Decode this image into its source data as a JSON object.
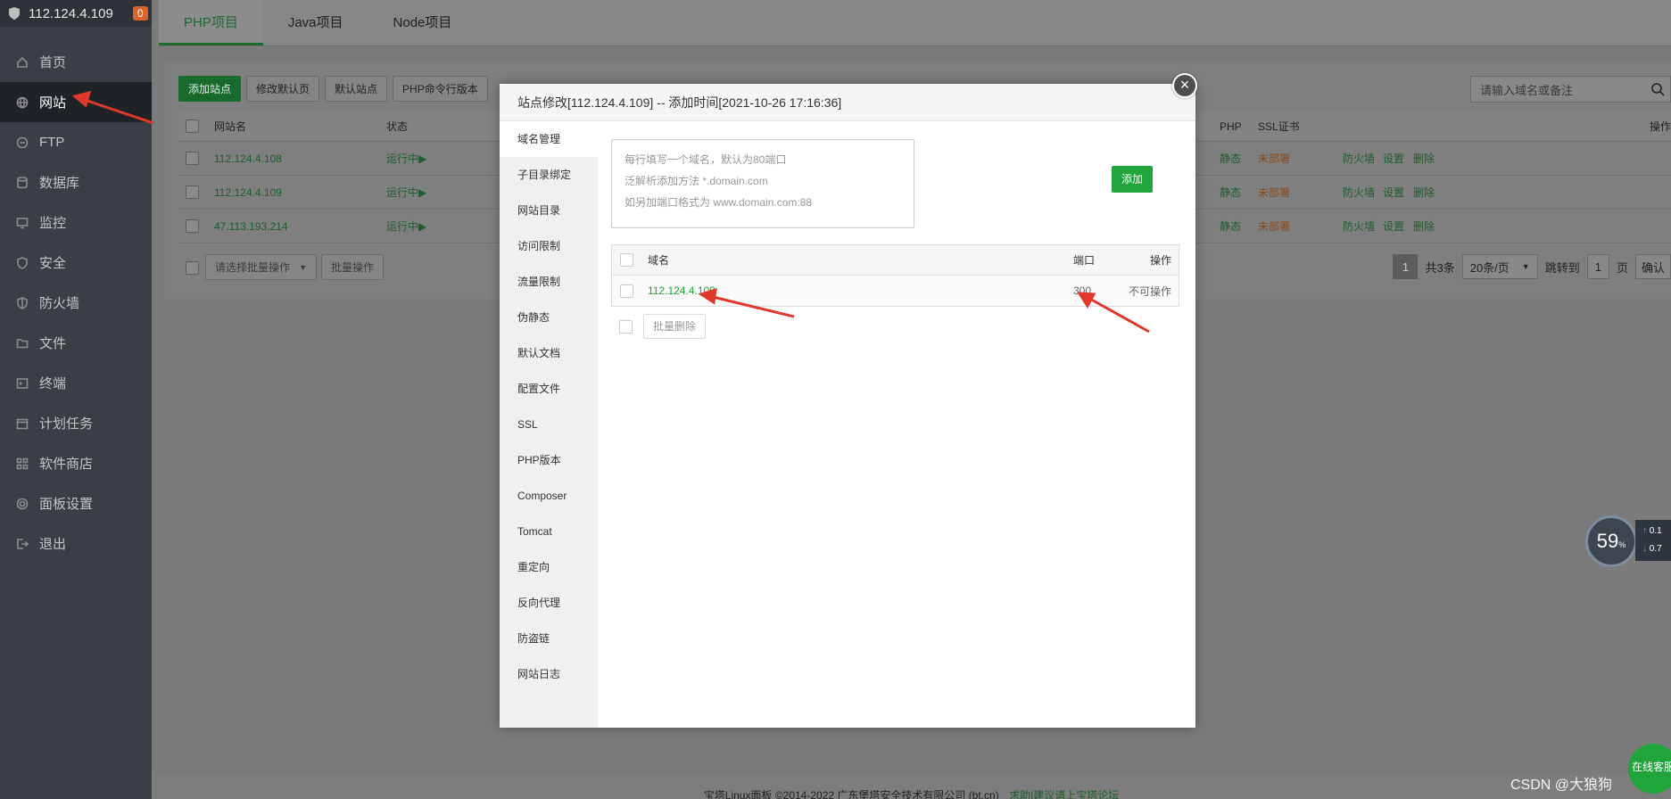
{
  "sidebar": {
    "host": "112.124.4.109",
    "badge": "0",
    "items": [
      {
        "label": "首页",
        "icon": "home-icon"
      },
      {
        "label": "网站",
        "icon": "globe-icon"
      },
      {
        "label": "FTP",
        "icon": "ftp-icon"
      },
      {
        "label": "数据库",
        "icon": "database-icon"
      },
      {
        "label": "监控",
        "icon": "monitor-icon"
      },
      {
        "label": "安全",
        "icon": "shield-icon"
      },
      {
        "label": "防火墙",
        "icon": "firewall-icon"
      },
      {
        "label": "文件",
        "icon": "folder-icon"
      },
      {
        "label": "终端",
        "icon": "terminal-icon"
      },
      {
        "label": "计划任务",
        "icon": "calendar-icon"
      },
      {
        "label": "软件商店",
        "icon": "apps-icon"
      },
      {
        "label": "面板设置",
        "icon": "gear-icon"
      },
      {
        "label": "退出",
        "icon": "logout-icon"
      }
    ]
  },
  "tabs": [
    "PHP项目",
    "Java项目",
    "Node项目"
  ],
  "toolbar": {
    "add_site": "添加站点",
    "edit_default_page": "修改默认页",
    "default_site": "默认站点",
    "php_cli": "PHP命令行版本"
  },
  "search": {
    "placeholder": "请输入域名或备注"
  },
  "table": {
    "headers": {
      "name": "网站名",
      "status": "状态",
      "php": "PHP",
      "ssl": "SSL证书",
      "ops": "操作"
    },
    "rows": [
      {
        "name": "112.124.4.108",
        "status": "运行中▶",
        "php": "静态",
        "ssl": "未部署",
        "firewall": "防火墙",
        "settings": "设置",
        "delete": "删除"
      },
      {
        "name": "112.124.4.109",
        "status": "运行中▶",
        "php": "静态",
        "ssl": "未部署",
        "firewall": "防火墙",
        "settings": "设置",
        "delete": "删除"
      },
      {
        "name": "47.113.193.214",
        "status": "运行中▶",
        "php": "静态",
        "ssl": "未部署",
        "firewall": "防火墙",
        "settings": "设置",
        "delete": "删除"
      }
    ],
    "batch_select": "请选择批量操作",
    "batch_btn": "批量操作"
  },
  "pager": {
    "current": "1",
    "total": "共3条",
    "per_page": "20条/页",
    "goto": "跳转到",
    "goto_value": "1",
    "page": "页",
    "confirm": "确认"
  },
  "footer": {
    "copyright": "宝塔Linux面板 ©2014-2022 广东堡塔安全技术有限公司 (bt.cn)",
    "feedback": "求助|建议请上宝塔论坛"
  },
  "modal": {
    "title": "站点修改[112.124.4.109] -- 添加时间[2021-10-26 17:16:36]",
    "menu": [
      "域名管理",
      "子目录绑定",
      "网站目录",
      "访问限制",
      "流量限制",
      "伪静态",
      "默认文档",
      "配置文件",
      "SSL",
      "PHP版本",
      "Composer",
      "Tomcat",
      "重定向",
      "反向代理",
      "防盗链",
      "网站日志"
    ],
    "input_placeholder": "每行填写一个域名，默认为80端口\n泛解析添加方法 *.domain.com\n如另加端口格式为 www.domain.com:88",
    "add_btn": "添加",
    "table_headers": {
      "domain": "域名",
      "port": "端口",
      "op": "操作"
    },
    "rows": [
      {
        "domain": "112.124.4.109",
        "port": "300",
        "op": "不可操作"
      }
    ],
    "batch_delete": "批量删除"
  },
  "widgets": {
    "gauge": "59",
    "gauge_unit": "%",
    "net_up": "0.1",
    "net_down": "0.7",
    "online": "在线客服",
    "watermark": "CSDN @大狼狗"
  }
}
